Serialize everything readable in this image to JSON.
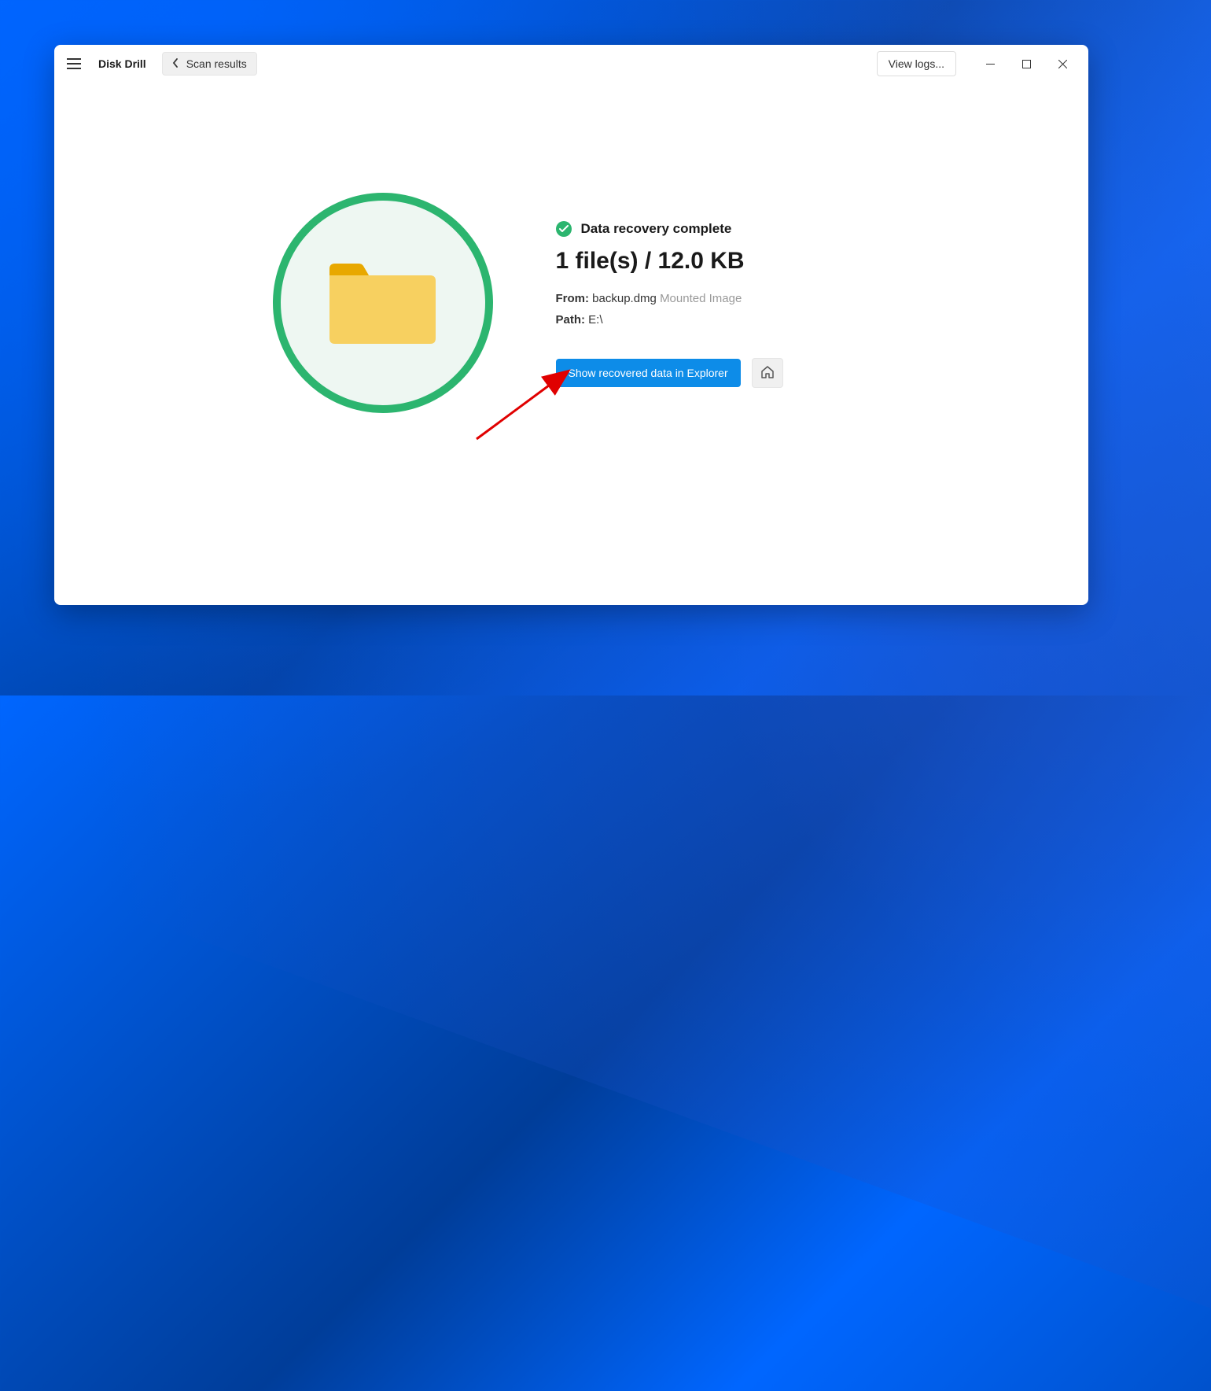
{
  "titlebar": {
    "app_title": "Disk Drill",
    "breadcrumb_label": "Scan results",
    "view_logs_label": "View logs..."
  },
  "status": {
    "text": "Data recovery complete"
  },
  "summary": {
    "text": "1 file(s) / 12.0 KB"
  },
  "source": {
    "label": "From:",
    "name": "backup.dmg",
    "type": "Mounted Image"
  },
  "path": {
    "label": "Path:",
    "value": "E:\\"
  },
  "actions": {
    "show_recovered_label": "Show recovered data in Explorer"
  }
}
